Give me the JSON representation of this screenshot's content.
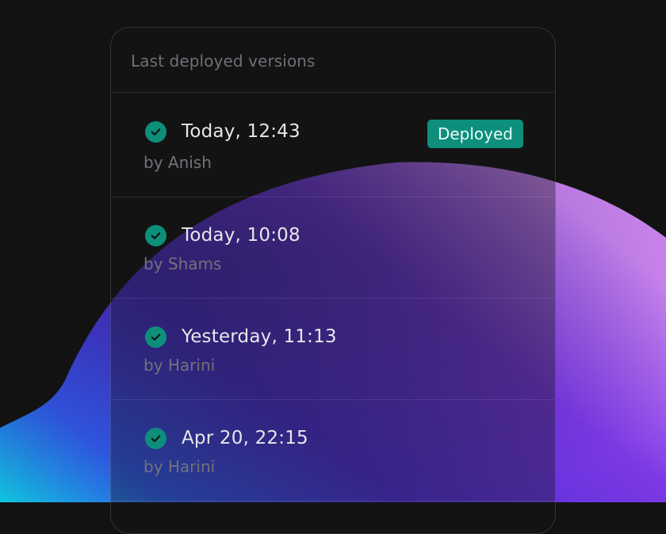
{
  "panel": {
    "title": "Last deployed versions"
  },
  "deployments": [
    {
      "time": "Today, 12:43",
      "author": "by Anish",
      "badge": "Deployed",
      "status": "success"
    },
    {
      "time": "Today, 10:08",
      "author": "by Shams",
      "status": "success"
    },
    {
      "time": "Yesterday, 11:13",
      "author": "by Harini",
      "status": "success"
    },
    {
      "time": "Apr 20, 22:15",
      "author": "by Harini",
      "status": "success"
    }
  ],
  "colors": {
    "background": "#121213",
    "success": "#0d8f7c",
    "text_primary": "#e6e6ea",
    "text_secondary": "#727279"
  },
  "icons": {
    "status": "check-circle-icon"
  }
}
